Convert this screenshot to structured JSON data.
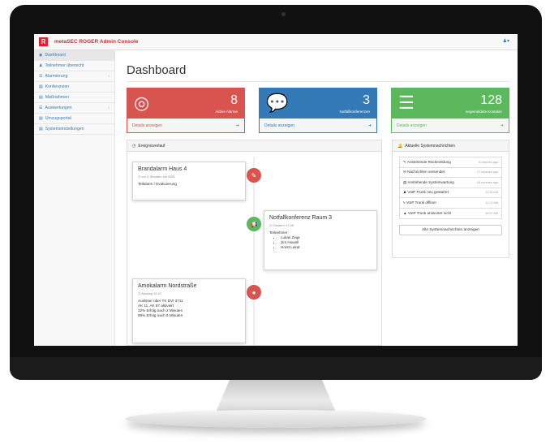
{
  "header": {
    "logo_letter": "R",
    "title": "metaSEC ROGER Admin Console",
    "user_menu": "♟▾"
  },
  "sidebar": {
    "items": [
      {
        "label": "Dashboard",
        "icon": "dashboard-icon",
        "glyph": "◉",
        "active": true,
        "caret": ""
      },
      {
        "label": "Teilnehmer übersicht",
        "icon": "users-icon",
        "glyph": "♟",
        "active": false,
        "caret": ""
      },
      {
        "label": "Alarmierung",
        "icon": "list-icon",
        "glyph": "☰",
        "active": false,
        "caret": "‹"
      },
      {
        "label": "Konferenzen",
        "icon": "chart-icon",
        "glyph": "▤",
        "active": false,
        "caret": ""
      },
      {
        "label": "Maßnahmen",
        "icon": "chart-icon",
        "glyph": "▤",
        "active": false,
        "caret": ""
      },
      {
        "label": "Auswertungen",
        "icon": "list-icon",
        "glyph": "☰",
        "active": false,
        "caret": "‹"
      },
      {
        "label": "Umzugsportal",
        "icon": "chart-icon",
        "glyph": "▤",
        "active": false,
        "caret": ""
      },
      {
        "label": "Systemeinstellungen",
        "icon": "chart-icon",
        "glyph": "▤",
        "active": false,
        "caret": ""
      }
    ]
  },
  "main": {
    "title": "Dashboard"
  },
  "panels": [
    {
      "value": "8",
      "label": "Aktive Alarme",
      "details": "Details anzeigen",
      "color": "#d9534f",
      "icon": "lifebuoy-icon"
    },
    {
      "value": "3",
      "label": "Notfallkonferenzen",
      "details": "Details anzeigen",
      "color": "#337ab7",
      "icon": "chat-icon"
    },
    {
      "value": "128",
      "label": "angemeldete Kontakte",
      "details": "Details anzeigen",
      "color": "#5cb85c",
      "icon": "server-icon"
    }
  ],
  "timeline": {
    "heading": "Ereignisverlauf",
    "events": [
      {
        "title": "Brandalarm Haus 4",
        "meta": "◷ vor 4 Stunden via SMS",
        "lines": [
          "Teilalarm / Evakuierung"
        ]
      },
      {
        "title": "Notfallkonferenz Raum 3",
        "meta": "◷ Gestern 17:45",
        "lines": [
          "Teilnehmer:"
        ],
        "list": [
          "Lukas Ziaja",
          "Jim Howell",
          "Horst Lukat"
        ]
      },
      {
        "title": "Amokalarm Nordstraße",
        "meta": "◷ Montag 12:47",
        "lines": [
          "Auslöser über TK DVI 3711",
          "AK 11, AK 87 aktiviert",
          "32% Erfolg nach 2 Minuten",
          "89% Erfolg nach 5 Minuten"
        ]
      }
    ]
  },
  "system": {
    "heading": "Aktuelle Systemnachrichten",
    "items": [
      {
        "icon": "comment-icon",
        "glyph": "✎",
        "text": "Anstehende Rückmeldung",
        "time": "4 minutes ago"
      },
      {
        "icon": "envelope-icon",
        "glyph": "✉",
        "text": "Nachrichten versendet",
        "time": "27 minutes ago"
      },
      {
        "icon": "server-icon",
        "glyph": "▤",
        "text": "Anstehende Systemwartung",
        "time": "43 minutes ago"
      },
      {
        "icon": "user-icon",
        "glyph": "♟",
        "text": "VoIP Trunk neu gestartet",
        "time": "11:32 AM"
      },
      {
        "icon": "bolt-icon",
        "glyph": "ϟ",
        "text": "VoIP Trunk offline!",
        "time": "11:13 AM"
      },
      {
        "icon": "warning-icon",
        "glyph": "▲",
        "text": "VoIP Trunk antwortet nicht",
        "time": "10:57 AM"
      }
    ],
    "button": "Alle Systemnachrichten anzeigen"
  },
  "colors": {
    "red": "#d9534f",
    "blue": "#337ab7",
    "green": "#5cb85c"
  }
}
